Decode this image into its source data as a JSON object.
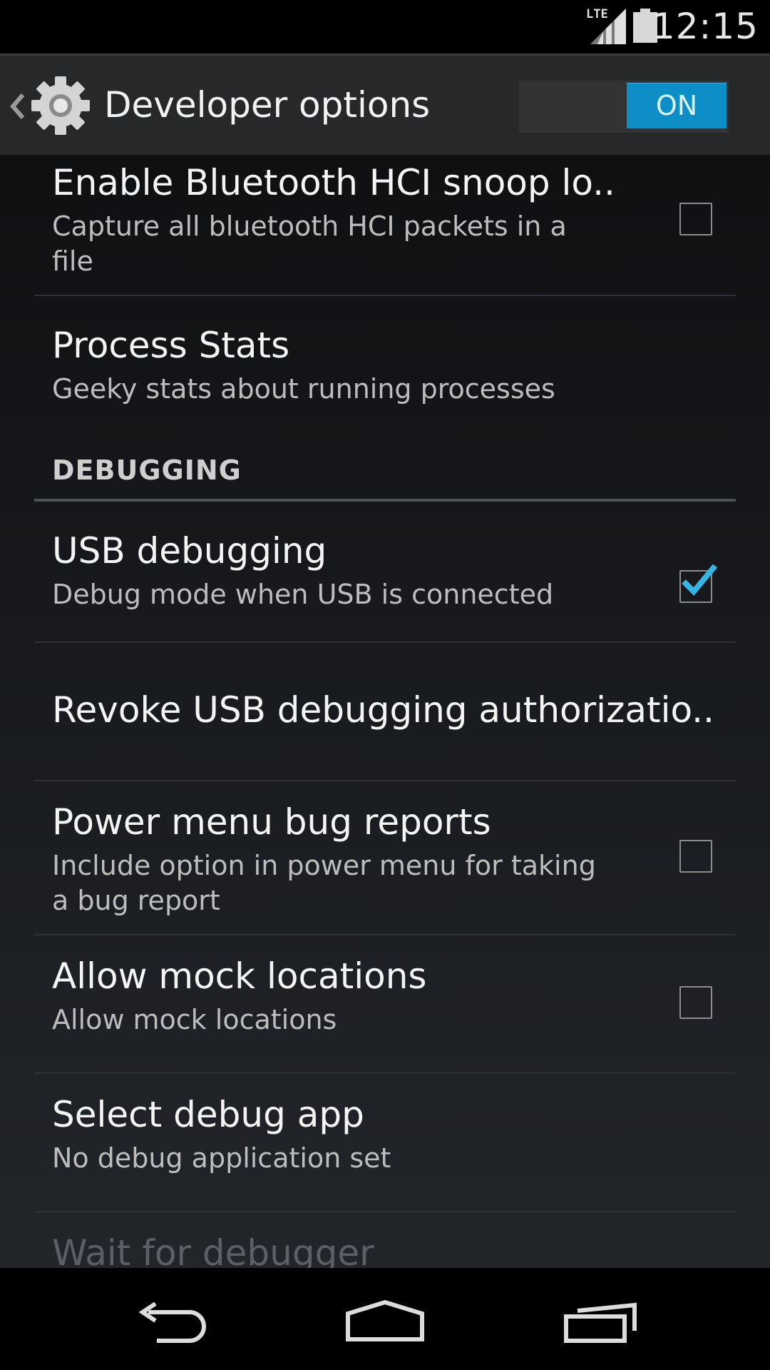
{
  "status_bar": {
    "time": "12:15",
    "network_label": "LTE",
    "icons": [
      "lte-signal-icon",
      "battery-icon"
    ]
  },
  "action_bar": {
    "title": "Developer options",
    "master_switch": {
      "state_label": "ON",
      "checked": true
    },
    "icons": [
      "back-chevron-icon",
      "gear-icon"
    ]
  },
  "preferences": {
    "bluetooth_snoop": {
      "title": "Enable Bluetooth HCI snoop lo..",
      "summary": "Capture all bluetooth HCI packets in a file",
      "checked": false
    },
    "process_stats": {
      "title": "Process Stats",
      "summary": "Geeky stats about running processes"
    },
    "debugging_header": "DEBUGGING",
    "usb_debugging": {
      "title": "USB debugging",
      "summary": "Debug mode when USB is connected",
      "checked": true
    },
    "revoke_usb": {
      "title": "Revoke USB debugging authorizatio.."
    },
    "power_menu_bug_reports": {
      "title": "Power menu bug reports",
      "summary": "Include option in power menu for taking a bug report",
      "checked": false
    },
    "mock_locations": {
      "title": "Allow mock locations",
      "summary": "Allow mock locations",
      "checked": false
    },
    "select_debug_app": {
      "title": "Select debug app",
      "summary": "No debug application set"
    },
    "wait_for_debugger": {
      "title": "Wait for debugger"
    }
  },
  "nav_bar": {
    "icons": [
      "nav-back-icon",
      "nav-home-icon",
      "nav-recents-icon"
    ]
  },
  "colors": {
    "accent": "#0e8ec7",
    "checkmark": "#33b5e5",
    "background": "#0f1012"
  }
}
